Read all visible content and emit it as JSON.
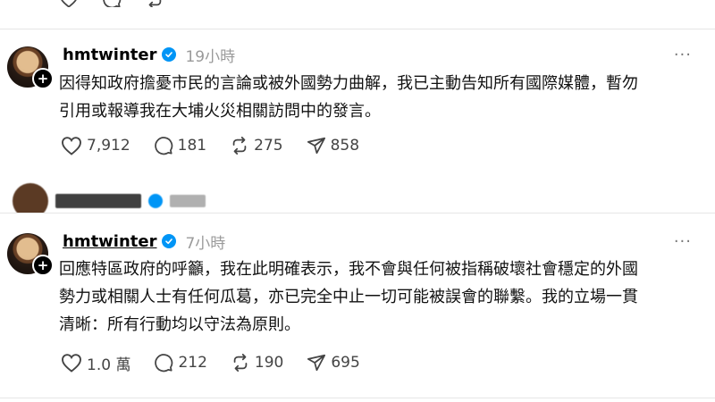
{
  "colors": {
    "verified": "#0095f6",
    "text": "#111111",
    "muted": "#9a9a9a",
    "divider": "#e6e6e6"
  },
  "posts": [
    {
      "username": "hmtwinter",
      "verified": true,
      "time": "19小時",
      "text_line1": "因得知政府擔憂市民的言論或被外國勢力曲解，我已主動告知所有國際媒體，暫勿",
      "text_line2": "引用或報導我在大埔火災相關訪問中的發言。",
      "likes": "7,912",
      "comments": "181",
      "reposts": "275",
      "shares": "858"
    },
    {
      "username": "hmtwinter",
      "verified": true,
      "time": "7小時",
      "text_line1": "回應特區政府的呼籲，我在此明確表示，我不會與任何被指稱破壞社會穩定的外國",
      "text_line2": "勢力或相關人士有任何瓜葛，亦已完全中止一切可能被誤會的聯繫。我的立場一貫",
      "text_line3": "清晰：所有行動均以守法為原則。",
      "likes": "1.0 萬",
      "comments": "212",
      "reposts": "190",
      "shares": "695"
    }
  ],
  "icons": {
    "like": "heart-icon",
    "comment": "comment-icon",
    "repost": "repost-icon",
    "share": "share-icon",
    "more": "more-icon",
    "verified": "verified-icon",
    "follow": "plus-icon"
  }
}
